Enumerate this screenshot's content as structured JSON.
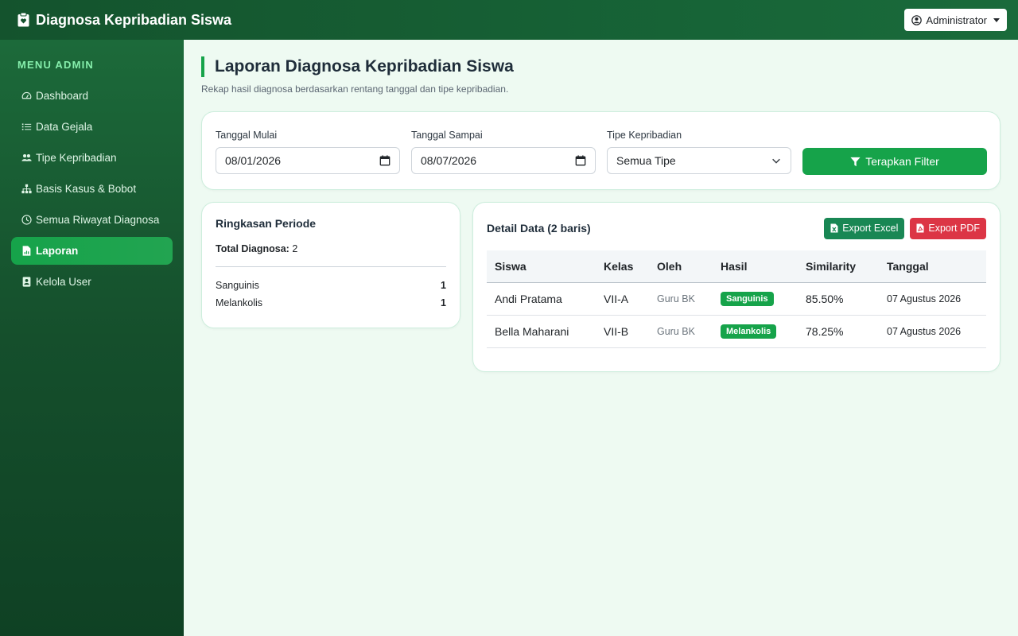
{
  "app": {
    "title": "Diagnosa Kepribadian Siswa"
  },
  "navbar": {
    "user_label": "Administrator"
  },
  "sidebar": {
    "heading": "MENU ADMIN",
    "items": [
      {
        "label": "Dashboard",
        "icon": "gauge-icon"
      },
      {
        "label": "Data Gejala",
        "icon": "list-icon"
      },
      {
        "label": "Tipe Kepribadian",
        "icon": "users-icon"
      },
      {
        "label": "Basis Kasus & Bobot",
        "icon": "sitemap-icon"
      },
      {
        "label": "Semua Riwayat Diagnosa",
        "icon": "clock-icon"
      },
      {
        "label": "Laporan",
        "icon": "report-icon",
        "active": true
      },
      {
        "label": "Kelola User",
        "icon": "user-card-icon"
      }
    ]
  },
  "page": {
    "title": "Laporan Diagnosa Kepribadian Siswa",
    "subtitle": "Rekap hasil diagnosa berdasarkan rentang tanggal dan tipe kepribadian."
  },
  "filter": {
    "start_label": "Tanggal Mulai",
    "start_value": "08/01/2026",
    "end_label": "Tanggal Sampai",
    "end_value": "08/07/2026",
    "type_label": "Tipe Kepribadian",
    "type_value": "Semua Tipe",
    "apply_label": "Terapkan Filter"
  },
  "summary": {
    "title": "Ringkasan Periode",
    "total_label": "Total Diagnosa:",
    "total_value": "2",
    "rows": [
      {
        "label": "Sanguinis",
        "count": "1"
      },
      {
        "label": "Melankolis",
        "count": "1"
      }
    ]
  },
  "detail": {
    "title": "Detail Data (2 baris)",
    "export_excel": "Export Excel",
    "export_pdf": "Export PDF",
    "columns": [
      "Siswa",
      "Kelas",
      "Oleh",
      "Hasil",
      "Similarity",
      "Tanggal"
    ],
    "rows": [
      {
        "siswa": "Andi Pratama",
        "kelas": "VII-A",
        "oleh": "Guru BK",
        "hasil": "Sanguinis",
        "similarity": "85.50%",
        "tanggal": "07 Agustus 2026"
      },
      {
        "siswa": "Bella Maharani",
        "kelas": "VII-B",
        "oleh": "Guru BK",
        "hasil": "Melankolis",
        "similarity": "78.25%",
        "tanggal": "07 Agustus 2026"
      }
    ]
  },
  "colors": {
    "primary": "#16a34a",
    "nav_dark": "#14532d",
    "danger": "#dc3545",
    "excel": "#198754",
    "background": "#eefaf2"
  }
}
